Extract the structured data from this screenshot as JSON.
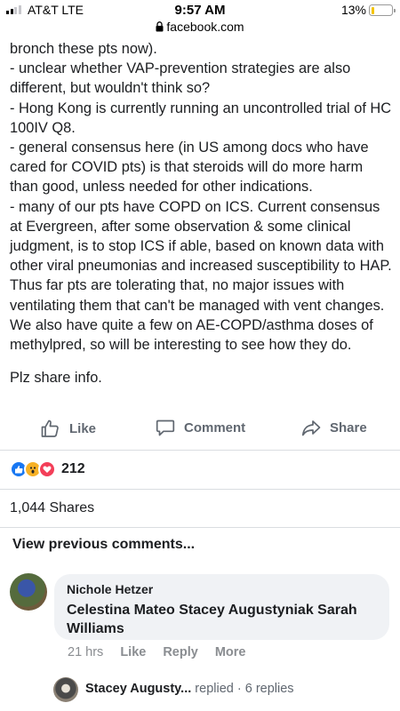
{
  "status_bar": {
    "carrier": "AT&T  LTE",
    "time": "9:57 AM",
    "battery": "13%",
    "battery_level": 0.13,
    "signal_bars": 2
  },
  "browser": {
    "url": "facebook.com"
  },
  "post": {
    "paragraphs": [
      "bronch these pts now).",
      "- unclear whether VAP-prevention strategies are also different, but wouldn't think so?",
      "- Hong Kong is currently running an uncontrolled trial of HC 100IV Q8.",
      "- general consensus here (in US among docs who have cared for COVID pts) is that steroids will do more harm than good, unless needed for other indications.",
      "- many of our pts have COPD on ICS. Current consensus at Evergreen, after some observation & some clinical judgment, is to stop ICS if able, based on known data with other viral pneumonias and increased susceptibility to HAP. Thus far pts are tolerating that, no major issues with ventilating them that can't be managed with vent changes. We also have quite a few on AE-COPD/asthma doses of methylpred, so will be interesting to see how they do."
    ],
    "closing": "Plz share info."
  },
  "actions": {
    "like": "Like",
    "comment": "Comment",
    "share": "Share"
  },
  "reactions": {
    "types": [
      "like",
      "wow",
      "love"
    ],
    "count": "212"
  },
  "shares": "1,044 Shares",
  "comments": {
    "view_previous": "View previous comments...",
    "items": [
      {
        "author": "Nichole Hetzer",
        "text": "Celestina Mateo Stacey Augustyniak Sarah Williams",
        "time": "21 hrs",
        "like": "Like",
        "reply": "Reply",
        "more": "More"
      }
    ],
    "reply_summary": {
      "name": "Stacey Augusty...",
      "action": "replied",
      "separator": "·",
      "replies": "6 replies"
    }
  },
  "colors": {
    "text": "#1c1e21",
    "secondary": "#606770",
    "like_blue": "#1877f2",
    "wow_yellow": "#f7b125",
    "love_red": "#f33e58",
    "bubble_bg": "#f0f2f5"
  }
}
